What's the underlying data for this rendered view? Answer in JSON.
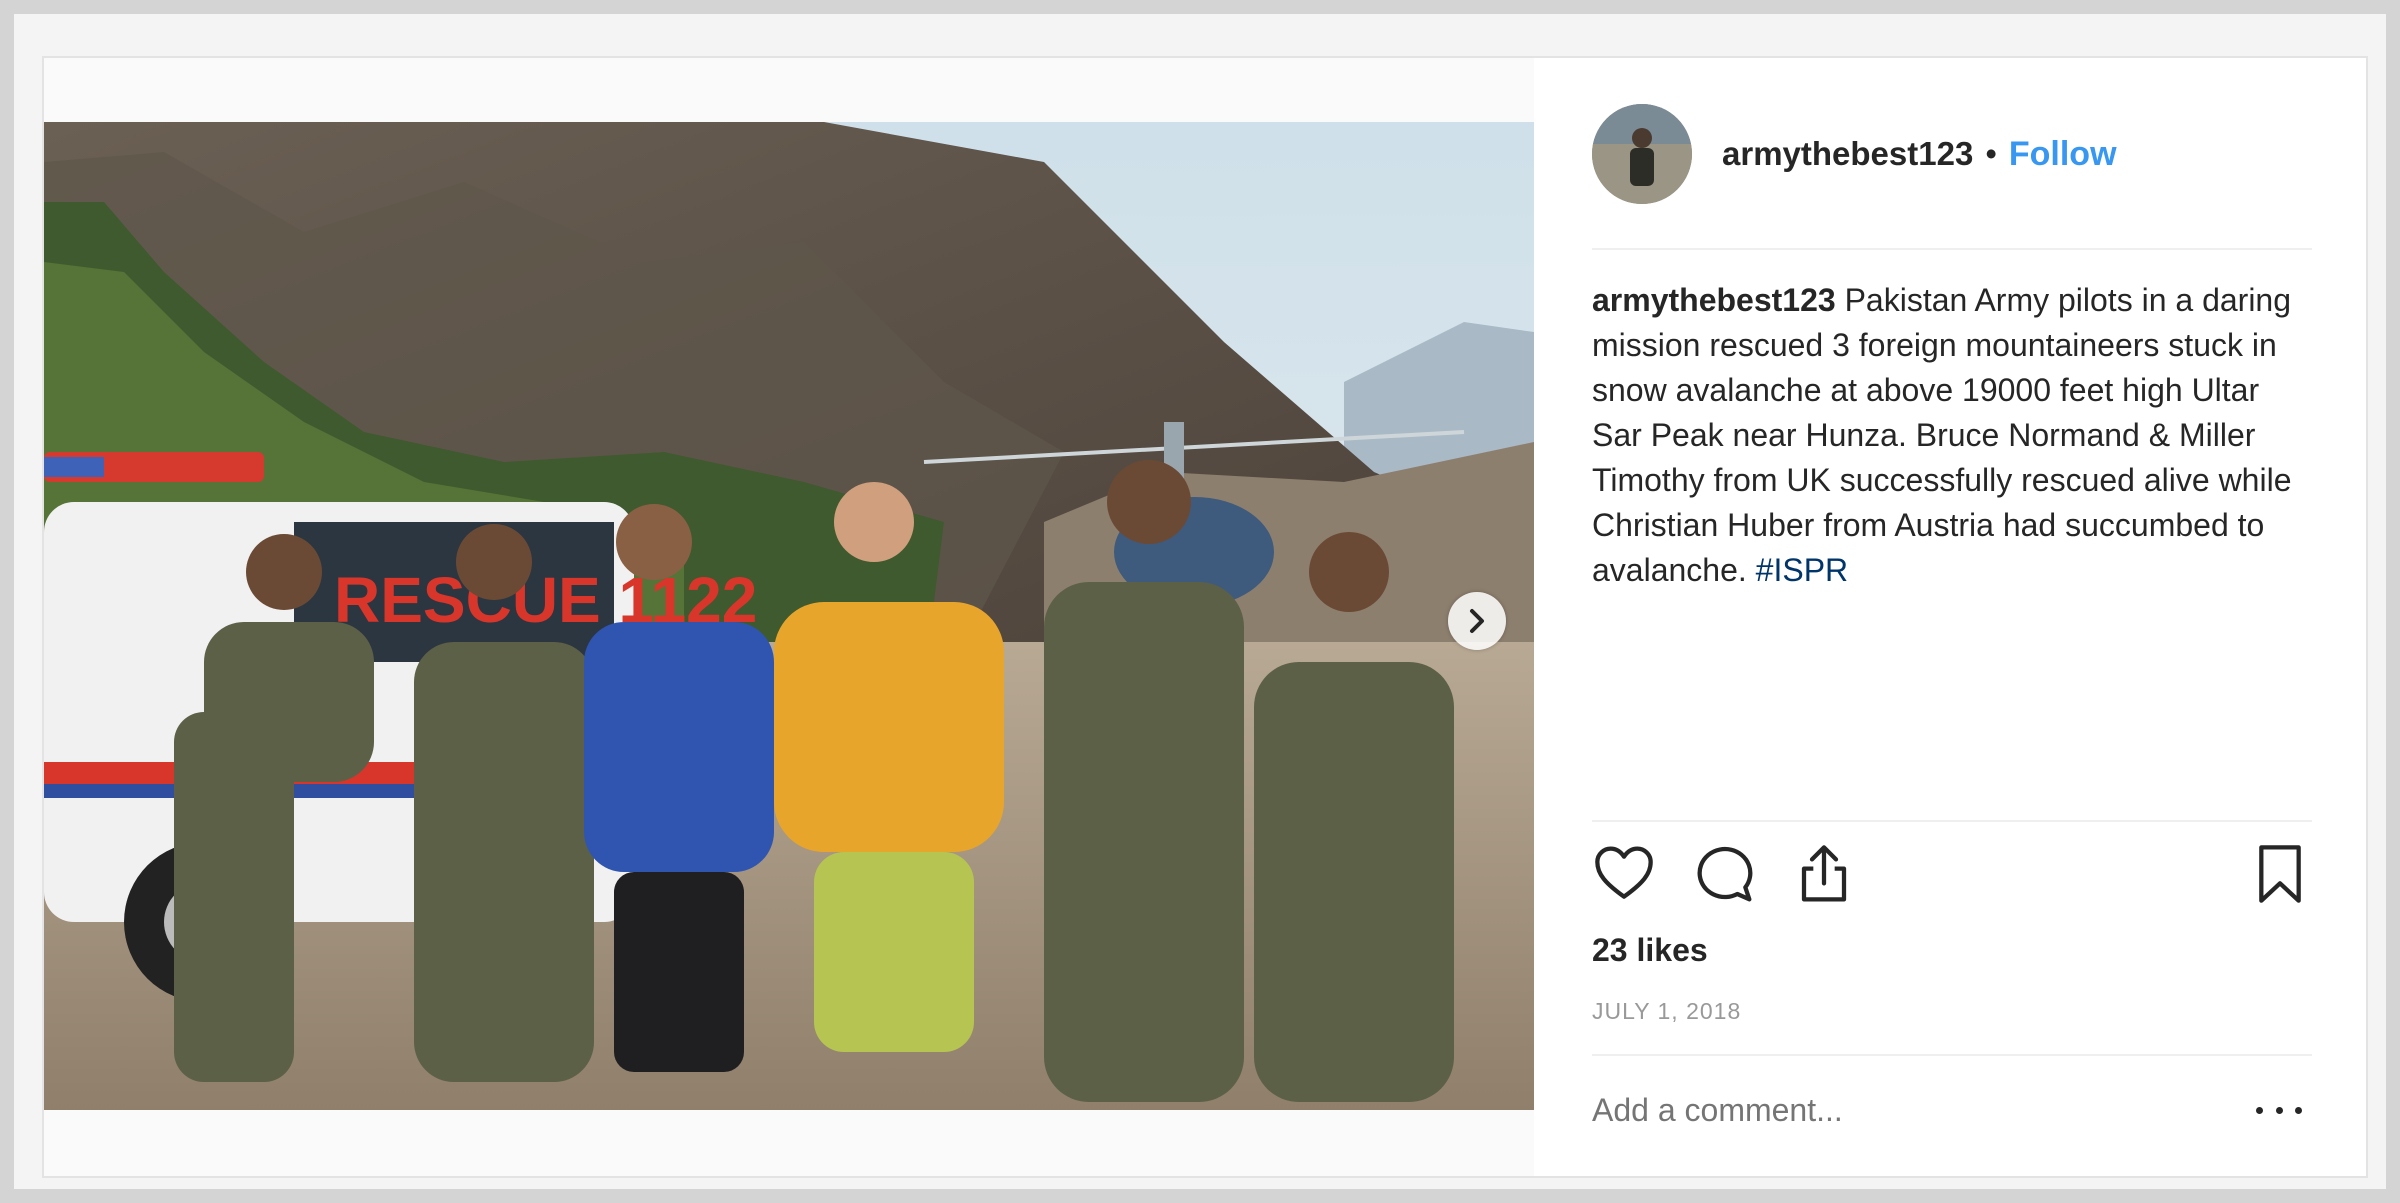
{
  "post": {
    "username": "armythebest123",
    "separator": "•",
    "follow_label": "Follow",
    "caption_user": "armythebest123",
    "caption_text": " Pakistan Army pilots in a daring mission rescued 3 foreign mountaineers stuck in snow avalanche at above 19000 feet high Ultar Sar Peak near Hunza. Bruce Normand & Miller Timothy from UK successfully rescued alive while Christian Huber from Austria had succumbed to avalanche. ",
    "caption_hashtag": "#ISPR",
    "likes": "23 likes",
    "date": "JULY 1, 2018",
    "comment_placeholder": "Add a comment...",
    "photo_text": "RESCUE 1122"
  },
  "icons": {
    "like": "heart-icon",
    "comment": "speech-bubble-icon",
    "share": "share-icon",
    "save": "bookmark-icon",
    "next": "chevron-right-icon",
    "more": "ellipsis-icon"
  },
  "colors": {
    "follow": "#3897f0",
    "hashtag": "#003569",
    "text": "#262626",
    "muted": "#999999"
  },
  "carousel": {
    "slides": 2,
    "active": 0
  }
}
